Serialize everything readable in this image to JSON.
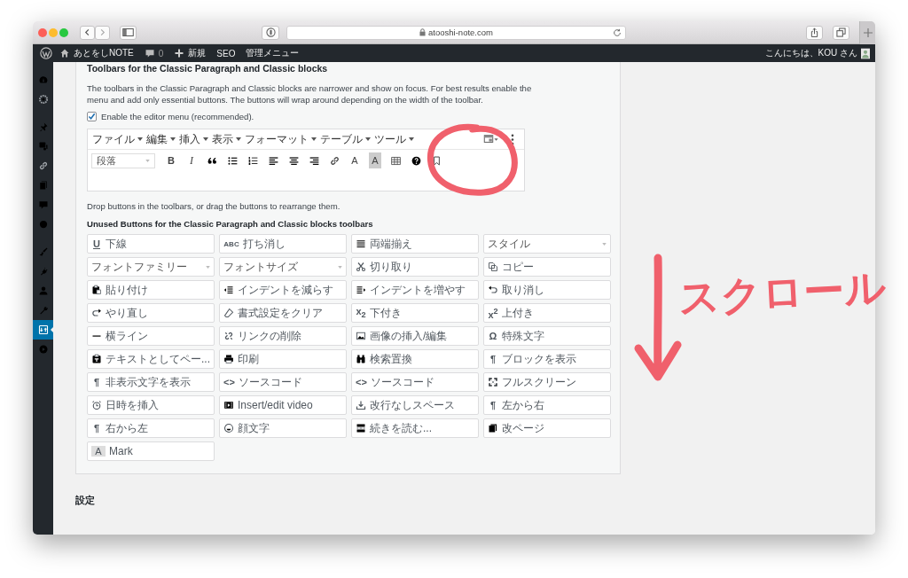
{
  "browser": {
    "url": "atooshi-note.com"
  },
  "admin_bar": {
    "items": [
      {
        "kind": "logo"
      },
      {
        "kind": "site",
        "label": "あとをしNOTE"
      },
      {
        "kind": "comments",
        "label": "0"
      },
      {
        "kind": "new",
        "label": "新規"
      },
      {
        "kind": "text",
        "label": "SEO"
      },
      {
        "kind": "text",
        "label": "管理メニュー"
      }
    ],
    "greeting": "こんにちは、KOU さん"
  },
  "sidebar": {
    "items": [
      {
        "selected": false
      },
      {
        "selected": false
      },
      {
        "selected": false
      },
      {
        "selected": false
      },
      {
        "selected": false
      },
      {
        "selected": false
      },
      {
        "selected": false
      },
      {
        "selected": false
      },
      {
        "selected": false
      },
      {
        "selected": false
      },
      {
        "selected": false
      },
      {
        "selected": false
      },
      {
        "selected": true
      },
      {
        "selected": false
      }
    ]
  },
  "section": {
    "title": "Toolbars for the Classic Paragraph and Classic blocks",
    "description": "The toolbars in the Classic Paragraph and Classic blocks are narrower and show on focus. For best results enable the menu and add only essential buttons. The buttons will wrap around depending on the width of the toolbar.",
    "checkbox": {
      "label": "Enable the editor menu (recommended).",
      "checked": true
    },
    "editor": {
      "menus": [
        "ファイル",
        "編集",
        "挿入",
        "表示",
        "フォーマット",
        "テーブル",
        "ツール"
      ],
      "format": "段落",
      "toolbar": [
        {
          "kind": "bold",
          "glyph": "B"
        },
        {
          "kind": "italic",
          "glyph": "I"
        },
        {
          "kind": "icon"
        },
        {
          "kind": "icon"
        },
        {
          "kind": "icon"
        },
        {
          "kind": "icon"
        },
        {
          "kind": "icon"
        },
        {
          "kind": "icon"
        },
        {
          "kind": "icon"
        },
        {
          "kind": "glyph",
          "glyph": "A"
        },
        {
          "kind": "highlight",
          "glyph": "A"
        },
        {
          "kind": "icon"
        },
        {
          "kind": "icon"
        },
        {
          "kind": "icon"
        }
      ]
    },
    "hint": "Drop buttons in the toolbars, or drag the buttons to rearrange them.",
    "unused_title": "Unused Buttons for the Classic Paragraph and Classic blocks toolbars",
    "unused_buttons": [
      {
        "kind": "button",
        "glyph": "U",
        "label": "下線"
      },
      {
        "kind": "button",
        "glyph": "ABC",
        "label": "打ち消し"
      },
      {
        "kind": "button",
        "label": "両端揃え"
      },
      {
        "kind": "select",
        "label": "スタイル"
      },
      {
        "kind": "select",
        "label": "フォントファミリー"
      },
      {
        "kind": "select",
        "label": "フォントサイズ"
      },
      {
        "kind": "button",
        "label": "切り取り"
      },
      {
        "kind": "button",
        "label": "コピー"
      },
      {
        "kind": "button",
        "label": "貼り付け"
      },
      {
        "kind": "button",
        "label": "インデントを減らす"
      },
      {
        "kind": "button",
        "label": "インデントを増やす"
      },
      {
        "kind": "button",
        "label": "取り消し"
      },
      {
        "kind": "button",
        "label": "やり直し"
      },
      {
        "kind": "button",
        "label": "書式設定をクリア"
      },
      {
        "kind": "button",
        "glyph": "x$_{2}$",
        "label": "下付き"
      },
      {
        "kind": "button",
        "glyph": "x$^{2}$",
        "label": "上付き"
      },
      {
        "kind": "button",
        "label": "横ライン"
      },
      {
        "kind": "button",
        "label": "リンクの削除"
      },
      {
        "kind": "button",
        "label": "画像の挿入/編集"
      },
      {
        "kind": "button",
        "glyph": "Ω",
        "label": "特殊文字"
      },
      {
        "kind": "button",
        "label": "テキストとしてペー..."
      },
      {
        "kind": "button",
        "label": "印刷"
      },
      {
        "kind": "button",
        "label": "検索置換"
      },
      {
        "kind": "button",
        "glyph": "¶",
        "label": "ブロックを表示"
      },
      {
        "kind": "button",
        "glyph": "¶",
        "label": "非表示文字を表示"
      },
      {
        "kind": "button",
        "glyph": "<>",
        "label": "ソースコード"
      },
      {
        "kind": "button",
        "glyph": "<>",
        "label": "ソースコード"
      },
      {
        "kind": "button",
        "label": "フルスクリーン"
      },
      {
        "kind": "button",
        "label": "日時を挿入"
      },
      {
        "kind": "button",
        "label": "Insert/edit video"
      },
      {
        "kind": "button",
        "label": "改行なしスペース"
      },
      {
        "kind": "button",
        "glyph": "¶",
        "label": "左から右"
      },
      {
        "kind": "button",
        "glyph": "¶",
        "label": "右から左"
      },
      {
        "kind": "button",
        "label": "顔文字"
      },
      {
        "kind": "button",
        "label": "続きを読む..."
      },
      {
        "kind": "button",
        "label": "改ページ"
      },
      {
        "kind": "mark",
        "glyph": "A",
        "label": "Mark"
      }
    ]
  },
  "next_heading": "設定",
  "annotation": {
    "text": "スクロール"
  }
}
